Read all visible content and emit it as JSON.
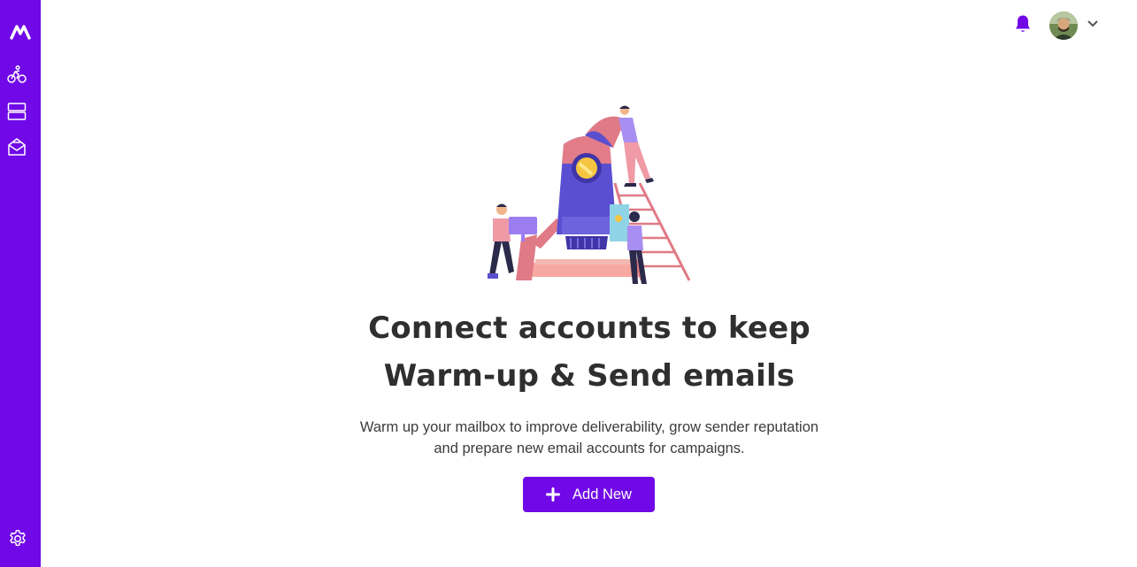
{
  "sidebar": {
    "icons": [
      "logo-icon",
      "bicycle-icon",
      "server-icon",
      "inbox-icon",
      "gear-icon"
    ]
  },
  "topbar": {
    "icons": [
      "bell-icon",
      "chevron-down-icon"
    ]
  },
  "empty_state": {
    "title_line1": "Connect accounts to keep",
    "title_line2": "Warm-up & Send emails",
    "description_line1": "Warm up your mailbox to improve deliverability, grow sender reputation",
    "description_line2": "and prepare new email accounts for campaigns.",
    "add_button_label": "Add New"
  },
  "colors": {
    "brand": "#7008e7",
    "text": "#2f2f2f"
  }
}
